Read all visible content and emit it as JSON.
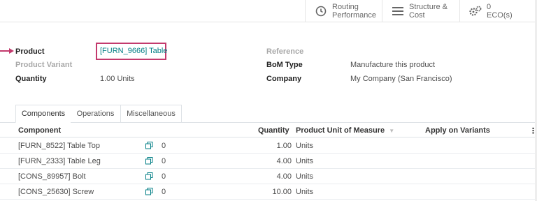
{
  "smart_buttons": [
    {
      "icon": "clock-icon",
      "line1": "Routing",
      "line2": "Performance"
    },
    {
      "icon": "bars-icon",
      "line1": "Structure &",
      "line2": "Cost"
    },
    {
      "icon": "gears-icon",
      "line1": "0",
      "line2": "ECO(s)"
    }
  ],
  "form": {
    "product_label": "Product",
    "product_value": "[FURN_9666] Table",
    "variant_label": "Product Variant",
    "quantity_label": "Quantity",
    "quantity_value": "1.00",
    "quantity_unit": "Units",
    "reference_label": "Reference",
    "bom_type_label": "BoM Type",
    "bom_type_value": "Manufacture this product",
    "company_label": "Company",
    "company_value": "My Company (San Francisco)"
  },
  "tabs": [
    "Components",
    "Operations",
    "Miscellaneous"
  ],
  "table": {
    "headers": {
      "component": "Component",
      "quantity": "Quantity",
      "uom": "Product Unit of Measure",
      "variants": "Apply on Variants"
    },
    "rows": [
      {
        "component": "[FURN_8522] Table Top",
        "count": "0",
        "quantity": "1.00",
        "uom": "Units"
      },
      {
        "component": "[FURN_2333] Table Leg",
        "count": "0",
        "quantity": "4.00",
        "uom": "Units"
      },
      {
        "component": "[CONS_89957] Bolt",
        "count": "0",
        "quantity": "4.00",
        "uom": "Units"
      },
      {
        "component": "[CONS_25630] Screw",
        "count": "0",
        "quantity": "10.00",
        "uom": "Units"
      }
    ]
  },
  "colors": {
    "accent": "#017e84",
    "highlight": "#c33a6d"
  }
}
